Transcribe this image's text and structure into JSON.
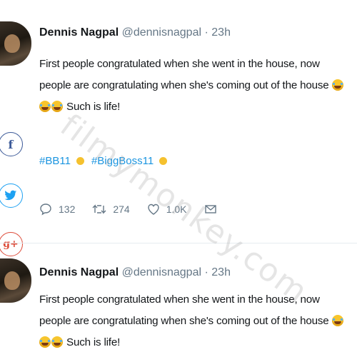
{
  "watermark": "filmymonkey.com",
  "tweets": [
    {
      "name": "Dennis Nagpal",
      "handle": "@dennisnagpal",
      "sep": "·",
      "time": "23h",
      "text_part1": "First people congratulated when she went in the house, now people are congratulating when she's coming out of the house",
      "text_part2": "Such is life!",
      "hashtags": [
        "#BB11",
        "#BiggBoss11"
      ],
      "replies": "132",
      "retweets": "274",
      "likes": "1.0K"
    },
    {
      "name": "Dennis Nagpal",
      "handle": "@dennisnagpal",
      "sep": "·",
      "time": "23h",
      "text_part1": "First people congratulated when she went in the house, now people are congratulating when she's coming out of the house",
      "text_part2": "Such is life!"
    }
  ],
  "share": {
    "facebook": "f",
    "google_plus": "g+"
  },
  "icons": [
    "reply-icon",
    "retweet-icon",
    "like-icon",
    "message-icon",
    "facebook-icon",
    "twitter-icon",
    "google-plus-icon",
    "laughing-emoji-icon",
    "trophy-icon"
  ]
}
